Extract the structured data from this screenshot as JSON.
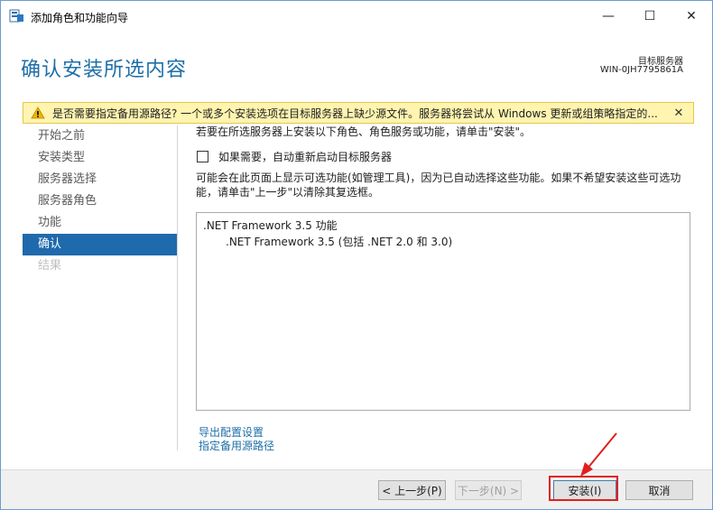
{
  "window": {
    "title": "添加角色和功能向导",
    "minimize_glyph": "—",
    "maximize_glyph": "☐",
    "close_glyph": "✕"
  },
  "header": {
    "title": "确认安装所选内容",
    "target_label": "目标服务器",
    "target_name": "WIN-0JH7795861A"
  },
  "warning": {
    "icon": "warning-icon",
    "text": "是否需要指定备用源路径? 一个或多个安装选项在目标服务器上缺少源文件。服务器将尝试从 Windows 更新或组策略指定的...",
    "close_glyph": "✕"
  },
  "sidebar": {
    "items": [
      {
        "label": "开始之前",
        "state": "normal"
      },
      {
        "label": "安装类型",
        "state": "normal"
      },
      {
        "label": "服务器选择",
        "state": "normal"
      },
      {
        "label": "服务器角色",
        "state": "normal"
      },
      {
        "label": "功能",
        "state": "normal"
      },
      {
        "label": "确认",
        "state": "active"
      },
      {
        "label": "结果",
        "state": "disabled"
      }
    ]
  },
  "content": {
    "intro": "若要在所选服务器上安装以下角色、角色服务或功能，请单击\"安装\"。",
    "restart_checkbox_label": "如果需要，自动重新启动目标服务器",
    "note": "可能会在此页面上显示可选功能(如管理工具)，因为已自动选择这些功能。如果不希望安装这些可选功能，请单击\"上一步\"以清除其复选框。",
    "features": {
      "parent": ".NET Framework 3.5 功能",
      "child": ".NET Framework 3.5 (包括 .NET 2.0 和 3.0)"
    },
    "links": {
      "export": "导出配置设置",
      "alternate_source": "指定备用源路径"
    }
  },
  "footer": {
    "prev_label": "< 上一步(P)",
    "next_label": "下一步(N) >",
    "install_label": "安装(I)",
    "cancel_label": "取消"
  },
  "colors": {
    "accent": "#1f6aac",
    "title_blue": "#1e6fa8",
    "warning_bg": "#fff4b0",
    "highlight_red": "#e02020"
  }
}
